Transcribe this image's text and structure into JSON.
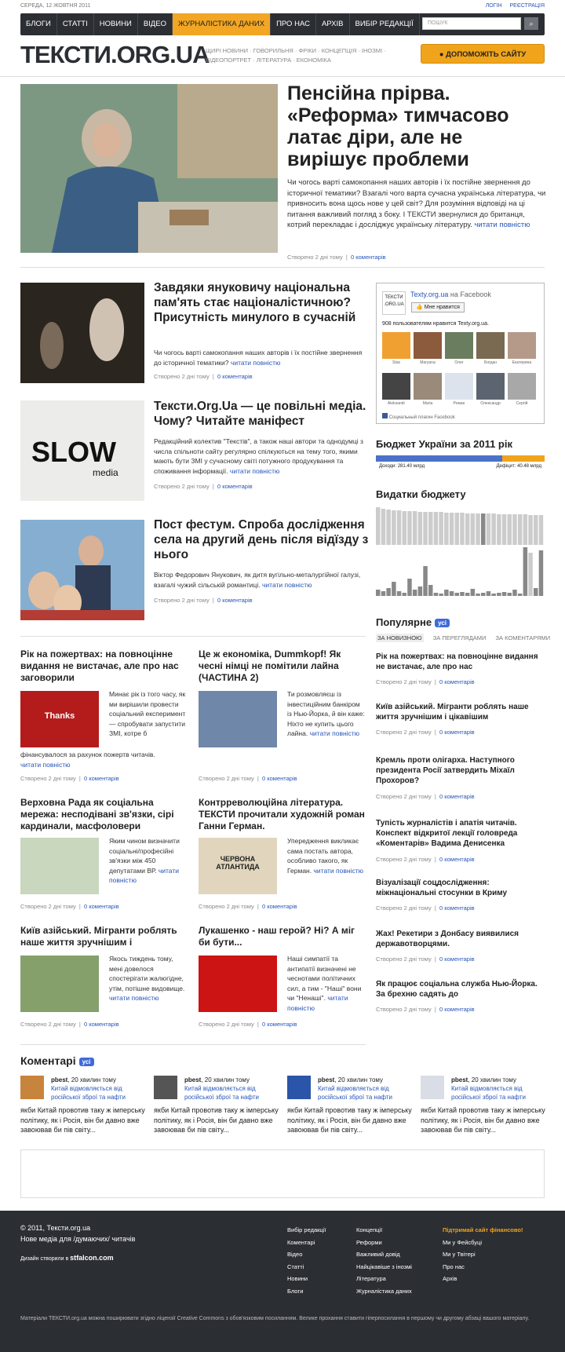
{
  "header": {
    "date": "СЕРЕДА, 12 ЖОВТНЯ 2011",
    "login": "ЛОГІН",
    "register": "РЕЄСТРАЦІЯ",
    "nav": [
      "БЛОГИ",
      "СТАТТІ",
      "НОВИНИ",
      "ВІДЕО",
      "ЖУРНАЛІСТИКА ДАНИХ",
      "ПРО НАС",
      "АРХІВ",
      "ВИБІР РЕДАКЦІЇ"
    ],
    "search_placeholder": "ПОШУК",
    "logo": "ТЕКСТИ.ORG.UA",
    "subnav": "ЩИРІ НОВИНИ · ГОВОРИЛЬНЯ · ФРІКИ · КОНЦЕПЦІЯ · ІНОЗМІ · ВІДЕОПОРТРЕТ · ЛІТЕРАТУРА · ЕКОНОМІКА",
    "donate": "ДОПОМОЖІТЬ САЙТУ"
  },
  "hero": {
    "title": "Пенсійна прірва. «Реформа» тимчасово латає діри, але не вирішує проблеми",
    "text": "Чи чогось варті самокопання наших авторів і їх постійне звернення до історичної тематики? Взагалі чого варта сучасна українська література, чи привносить вона щось нове у цей світ? Для розуміння відповіді на ці питання важливий погляд з боку. І ТЕКСТИ звернулися до британця, котрий перекладає і досліджує українську літературу.",
    "more": "читати повністю",
    "created": "Створено 2 дні тому",
    "comments": "0 коментарів"
  },
  "articles": [
    {
      "title": "Завдяки януковичу національна пам'ять стає націоналістичною? Присутність минулого в сучасній",
      "text": "Чи чогось варті самокопання наших авторів і їх постійне звернення до історичної тематики?",
      "more": "читати повністю",
      "created": "Створено 2 дні тому",
      "comments": "0 коментарів"
    },
    {
      "title": "Тексти.Org.Ua — це повільні медіа. Чому? Читайте маніфест",
      "text": "Редакційний колектив \"Текстів\", а також наші автори та однодумці з числа спільноти сайту регулярно спілкуються на тему того, якими мають бути ЗМІ у сучасному світі потужного продукування та споживання інформації.",
      "more": "читати повністю",
      "created": "Створено 2 дні тому",
      "comments": "0 коментарів",
      "img_label": "SLOW",
      "img_sub": "media"
    },
    {
      "title": "Пост фестум. Спроба дослідження села на другий день після відїзду з нього",
      "text": "Віктор Федорович Янукович, як дитя вугільно-металургійної галузі, взагалі чужий сільській романтиці.",
      "more": "читати повністю",
      "created": "Створено 2 дні тому",
      "comments": "0 коментарів"
    }
  ],
  "small": [
    {
      "title": "Рік на пожертвах: на повноцінне видання не вистачає, але про нас заговорили",
      "text": "Минає рік із того часу, як ми вирішили провести соціальний експеримент — спробувати запустити ЗМІ, котре б",
      "tail": "фінансувалося за рахунок пожертв читачів.",
      "more": "читати повністю",
      "created": "Створено 2 дні тому",
      "comments": "0 коментарів",
      "img_label": "Thanks"
    },
    {
      "title": "Це ж економіка, Dummkopf! Як чесні німці не помітили лайна (ЧАСТИНА 2)",
      "text": "Ти розмовляєш із інвестиційним банкіром із Нью-Йорка, й він каже: Ніхто не купить цього лайна.",
      "more": "читати повністю",
      "created": "Створено 2 дні тому",
      "comments": "0 коментарів"
    },
    {
      "title": "Верховна Рада як соціальна мережа: несподівані зв'язки, сірі кардинали, масфоловери",
      "text": "Яким чином визначити соціальні/професійні зв'язки між 450 депутатами ВР.",
      "more": "читати повністю",
      "created": "Створено 2 дні тому",
      "comments": "0 коментарів"
    },
    {
      "title": "Контрреволюційна література. ТЕКСТИ прочитали художній роман Ганни Герман.",
      "text": "Упередження викликає сама постать автора, особливо такого, як Герман.",
      "more": "читати повністю",
      "created": "Створено 2 дні тому",
      "comments": "0 коментарів",
      "img_label": "ЧЕРВОНА АТЛАНТИДА"
    },
    {
      "title": "Київ азійський. Мігранти роблять наше життя зручнішим і",
      "text": "Якось тиждень тому, мені довелося спостерігати жалюгідне, утім, потішне видовище.",
      "more": "читати повністю",
      "created": "Створено 2 дні тому",
      "comments": "0 коментарів"
    },
    {
      "title": "Лукашенко - наш герой? Ні? А міг би бути...",
      "text": "Наші симпатії та антипатії визначені не чеснотами політичних сил, а тим - \"Наші\" вони чи \"Ненаші\".",
      "more": "читати повністю",
      "created": "Створено 2 дні тому",
      "comments": "0 коментарів"
    }
  ],
  "facebook": {
    "name": "Texty.org.ua",
    "on": "на Facebook",
    "like": "Мне нравится",
    "count": "908 пользователям нравится Texty.org.ua.",
    "friends": [
      "Stas",
      "Maryana",
      "Олег",
      "Богдан",
      "Екатерина",
      "Aleksandr",
      "Maria",
      "Роман",
      "Олександр",
      "Сергій"
    ],
    "footer": "Социальный плагин Facebook"
  },
  "budget": {
    "title": "Бюджет України за 2011 рік",
    "income": "Доходи: 281.40 млрд",
    "deficit": "Дефіцит: 40.48 млрд",
    "share": 0.75,
    "expenses_title": "Видатки бюджету"
  },
  "popular": {
    "title": "Популярне",
    "badge": "усі",
    "tabs": [
      "ЗА НОВИЗНОЮ",
      "ЗА ПЕРЕГЛЯДАМИ",
      "ЗА КОМЕНТАРЯМИ"
    ],
    "items": [
      {
        "title": "Рік на пожертвах: на повноцінне видання не вистачає, але про нас",
        "created": "Створено 2 дні тому",
        "comments": "0 коментарів"
      },
      {
        "title": "Київ азійський. Мігранти роблять наше життя зручнішим і цікавішим",
        "created": "Створено 2 дні тому",
        "comments": "0 коментарів"
      },
      {
        "title": "Кремль проти олігарха. Наступного президента Росії затвердить Міхаїл Прохоров?",
        "created": "Створено 2 дні тому",
        "comments": "0 коментарів"
      },
      {
        "title": "Тупість журналістів і апатія читачів. Конспект відкритої лекції головреда «Коментарів» Вадима Денисенка",
        "created": "Створено 2 дні тому",
        "comments": "0 коментарів"
      },
      {
        "title": "Візуалізації соцдослідження: міжнаціональні стосунки в Криму",
        "created": "Створено 2 дні тому",
        "comments": "0 коментарів"
      },
      {
        "title": "Жах! Рекетири з Донбасу виявилися державотворцями.",
        "created": "Створено 2 дні тому",
        "comments": "0 коментарів"
      },
      {
        "title": "Як працює соціальна служба Нью-Йорка. За брехню садять до",
        "created": "Створено 2 дні тому",
        "comments": "0 коментарів"
      }
    ]
  },
  "comments": {
    "title": "Коментарі",
    "badge": "усі",
    "items": [
      {
        "author": "pbest",
        "time": ", 20 хвилин тому",
        "link": "Китай відмовляється від російської зброї та нафти",
        "text": "якби Китай провотив таку ж імперську політику, як і Росія, він би давно вже завоював би пів світу..."
      },
      {
        "author": "pbest",
        "time": ", 20 хвилин тому",
        "link": "Китай відмовляється від російської зброї та нафти",
        "text": "якби Китай провотив таку ж імперську політику, як і Росія, він би давно вже завоював би пів світу..."
      },
      {
        "author": "pbest",
        "time": ", 20 хвилин тому",
        "link": "Китай відмовляється від російської зброї та нафти",
        "text": "якби Китай провотив таку ж імперську політику, як і Росія, він би давно вже завоював би пів світу..."
      },
      {
        "author": "pbest",
        "time": ", 20 хвилин тому",
        "link": "Китай відмовляється від російської зброї та нафти",
        "text": "якби Китай провотив таку ж імперську політику, як і Росія, він би давно вже завоював би пів світу..."
      }
    ]
  },
  "footer": {
    "copyright": "© 2011, Тексти.org.ua",
    "tagline": "Нове медіа для /думаючих/ читачів",
    "design": "Дизайн створили в",
    "design_by": "stfalcon.com",
    "col1": [
      "Вибір редакції",
      "Коментарі",
      "Відео",
      "Статті",
      "Новини",
      "Блоги"
    ],
    "col2": [
      "Концепції",
      "Реформи",
      "Важливий довід",
      "Найцікавіше з інозмі",
      "Література",
      "Журналістика даних"
    ],
    "col3": [
      "Підтримай сайт фінансово!",
      "Ми у Фейсбуці",
      "Ми у Твітері",
      "Про нас",
      "Архів"
    ],
    "license": "Матеріали ТЕКСТИ.org.ua можна поширювати згідно ліцензії Creative Commons з обов'язковим посиланням. Велике прохання ставити гіперпосилання в першому чи другому абзаці вашого матеріалу."
  },
  "colors": {
    "accent": "#f0a41c",
    "nav": "#2b2e33",
    "link": "#2755b8"
  }
}
